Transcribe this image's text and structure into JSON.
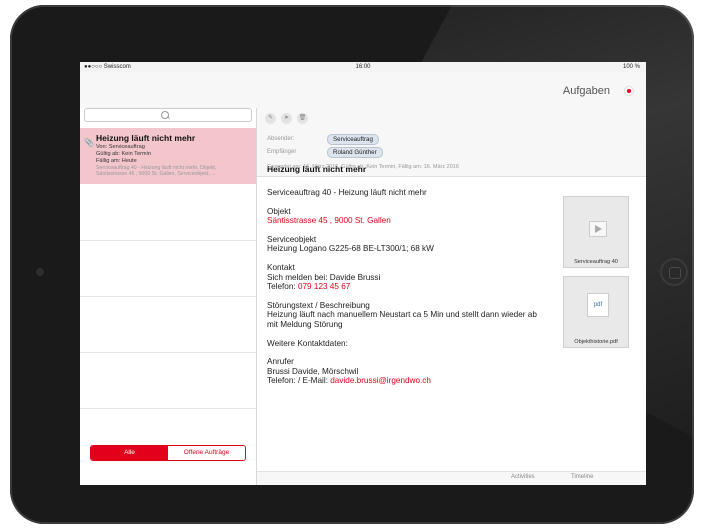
{
  "status": {
    "carrier": "●●○○○ Swisscom",
    "time": "16:00",
    "battery": "100 %"
  },
  "header": {
    "title": "Aufgaben"
  },
  "search": {
    "icon": "search-icon"
  },
  "list": {
    "items": [
      {
        "title": "Heizung läuft nicht mehr",
        "from": "Von: Serviceauftrag",
        "valid_from": "Gültig ab: Kein Termin",
        "due": "Fällig am: Heute",
        "preview_1": "Serviceauftrag 40 - Heizung läuft nicht mehr, Objekt,",
        "preview_2": "Säntisstrasse 45 , 9000 St. Gallen, Serviceobjekt, ..."
      }
    ],
    "filter": {
      "all": "Alle",
      "open": "Offene Aufträge"
    }
  },
  "detail": {
    "toolbar": {
      "icons": [
        "edit-icon",
        "forward-icon",
        "delete-icon"
      ]
    },
    "sender_label": "Absender:",
    "sender": "Serviceauftrag",
    "recipient_label": "Empfänger",
    "recipient": "Roland Günther",
    "subject": "Heizung läuft nicht mehr",
    "sent_info": "Gesendet am: 16. März 2016, Gültig ab: Kein Termin, Fällig am: 16. März 2016",
    "body": {
      "line1": "Serviceauftrag 40  - Heizung läuft nicht mehr",
      "objekt_label": "Objekt",
      "objekt_address": "Säntisstrasse 45 , 9000 St. Gallen",
      "serviceobjekt_label": "Serviceobjekt",
      "serviceobjekt_value": "Heizung Logano G225-68 BE-LT300/1; 68 kW",
      "kontakt_label": "Kontakt",
      "kontakt_value": "Sich melden bei: Davide Brussi",
      "telefon_label": "Telefon: ",
      "telefon_value": "079 123 45 67",
      "stoerung_label": "Störungstext / Beschreibung",
      "stoerung_text": "Heizung läuft nach manuellem Neustart ca 5 Min und stellt dann wieder ab\nmit Meldung Störung",
      "weitere": "Weitere Kontaktdaten:",
      "anrufer_label": "Anrufer",
      "anrufer_value": "Brussi Davide, Mörschwil",
      "tel_email_label": "Telefon: / E-Mail: ",
      "email": "davide.brussi@irgendwo.ch"
    },
    "attachments": [
      {
        "label": "Serviceauftrag 40",
        "type": "video"
      },
      {
        "label": "Objekthistorie.pdf",
        "type": "pdf",
        "badge": "pdf"
      }
    ],
    "tabs": {
      "activities": "Activities",
      "timeline": "Timeline"
    }
  },
  "colors": {
    "accent": "#e2001a",
    "selected_item": "#f3c6cc"
  }
}
